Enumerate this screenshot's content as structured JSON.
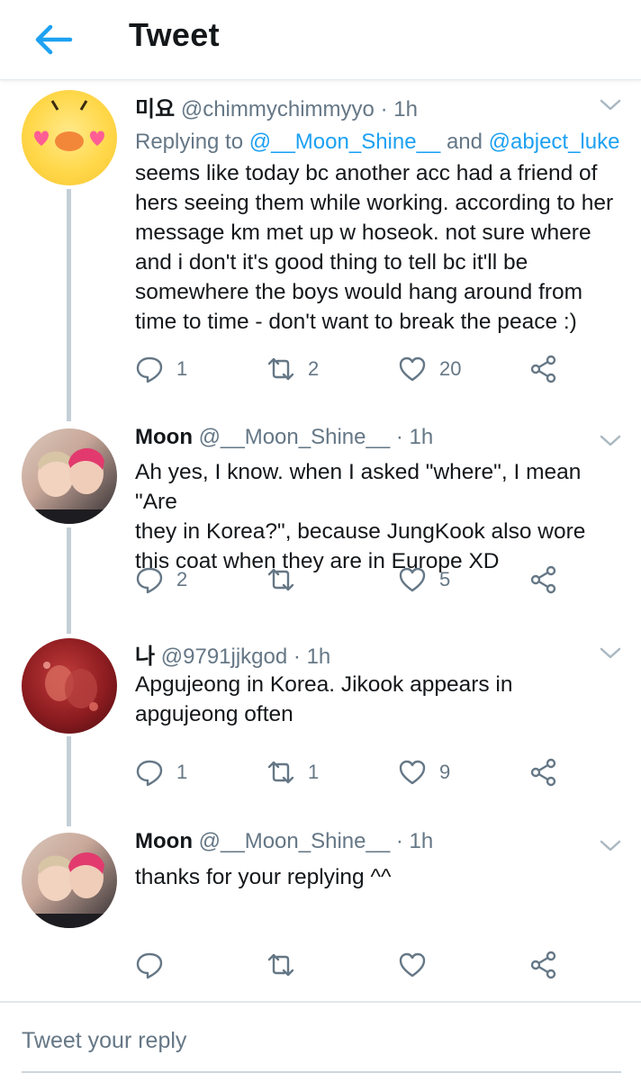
{
  "header": {
    "title": "Tweet",
    "back_icon": "arrow-left-icon",
    "accent": "#1da1f2"
  },
  "tweets": [
    {
      "name": "미요",
      "handle": "@chimmychimmyyo",
      "time": "· 1h",
      "replying_prefix": "Replying to ",
      "mention1": "@__Moon_Shine__",
      "and": " and ",
      "mention2": "@abject_luke",
      "lines": [
        "seems like today bc another acc had a friend of",
        "hers seeing them while working. according to her",
        "message km met up w hoseok. not sure where",
        "and i don't it's good thing to tell bc it'll be",
        "somewhere the boys would hang around from",
        "time to time - don't want to break the peace :)"
      ],
      "reply_count": "1",
      "retweet_count": "2",
      "like_count": "20"
    },
    {
      "name": "Moon",
      "handle": "@__Moon_Shine__",
      "time": "· 1h",
      "lines": [
        "Ah yes, I know. when I asked \"where\", I mean \"Are",
        "they in Korea?\", because JungKook also wore",
        "this coat when they are in Europe XD"
      ],
      "reply_count": "2",
      "retweet_count": "",
      "like_count": "5"
    },
    {
      "name": "나",
      "handle": "@9791jjkgod",
      "time": "· 1h",
      "lines": [
        "Apgujeong in Korea. Jikook appears in",
        "apgujeong often"
      ],
      "reply_count": "1",
      "retweet_count": "1",
      "like_count": "9"
    },
    {
      "name": "Moon",
      "handle": "@__Moon_Shine__",
      "time": "· 1h",
      "lines": [
        "thanks for your replying ^^"
      ],
      "reply_count": "",
      "retweet_count": "",
      "like_count": ""
    }
  ],
  "reply_box": {
    "placeholder": "Tweet your reply"
  },
  "icons": [
    "reply-icon",
    "retweet-icon",
    "like-icon",
    "share-icon",
    "chevron-down-icon"
  ]
}
